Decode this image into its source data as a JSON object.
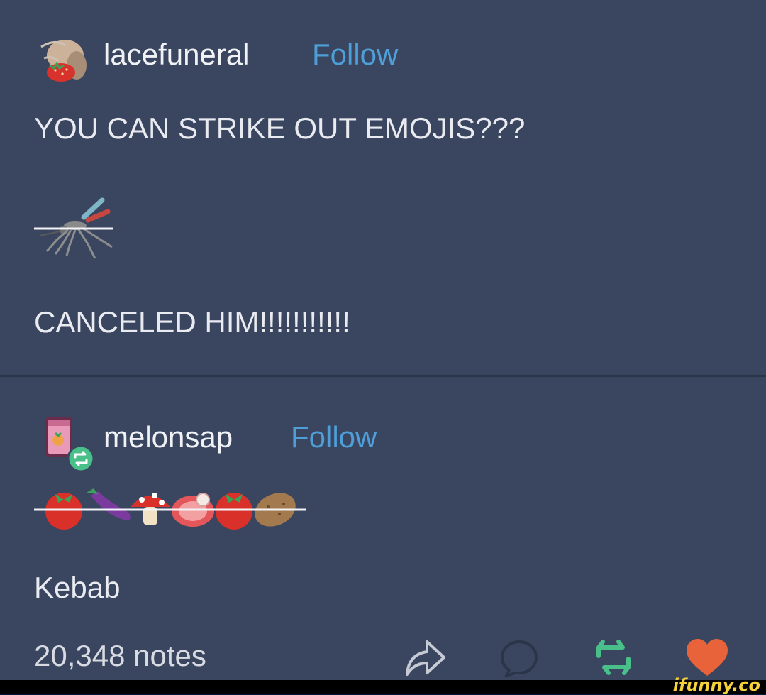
{
  "post1": {
    "username": "lacefuneral",
    "follow_label": "Follow",
    "text_line1": "YOU CAN STRIKE OUT EMOJIS???",
    "emoji_struck": "mosquito",
    "text_line2": "CANCELED HIM!!!!!!!!!!!"
  },
  "post2": {
    "username": "melonsap",
    "follow_label": "Follow",
    "emojis_struck": [
      "tomato",
      "eggplant",
      "mushroom",
      "meat",
      "tomato",
      "potato"
    ],
    "text": "Kebab"
  },
  "footer": {
    "notes": "20,348 notes",
    "icons": [
      "share-icon",
      "comment-icon",
      "reblog-icon",
      "like-heart-icon"
    ]
  },
  "watermark": "ifunny.co",
  "colors": {
    "background": "#3a4660",
    "follow": "#4e9fd8",
    "reblog": "#49c08a",
    "heart": "#e8633a"
  }
}
